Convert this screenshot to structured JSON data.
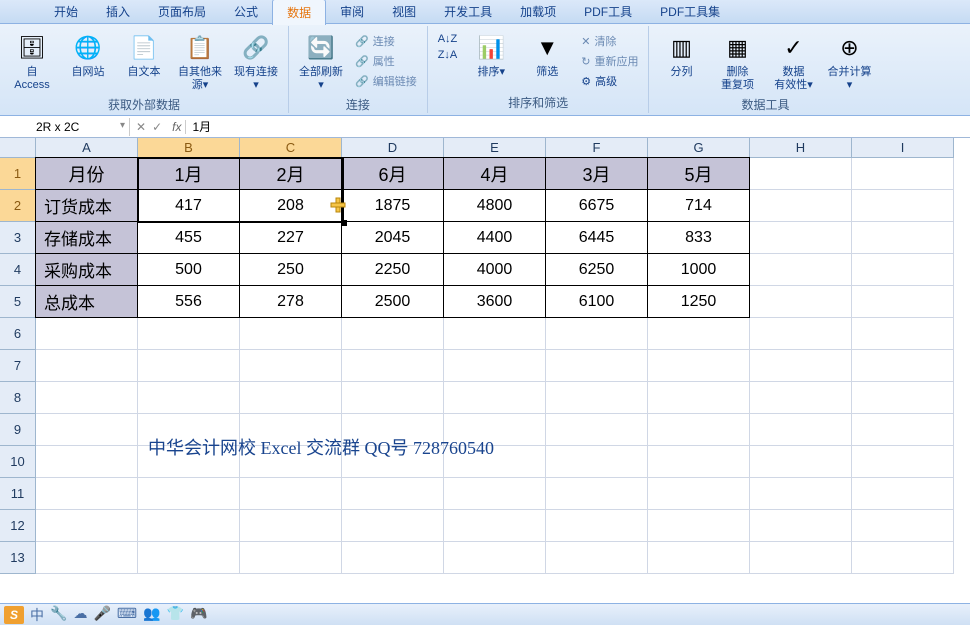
{
  "ribbon": {
    "tabs": [
      "开始",
      "插入",
      "页面布局",
      "公式",
      "数据",
      "审阅",
      "视图",
      "开发工具",
      "加载项",
      "PDF工具",
      "PDF工具集"
    ],
    "active_tab": "数据",
    "groups": {
      "get_data": {
        "label": "获取外部数据",
        "items": [
          "自 Access",
          "自网站",
          "自文本",
          "自其他来源",
          "现有连接"
        ]
      },
      "connections": {
        "label": "连接",
        "main": "全部刷新",
        "sub": [
          "连接",
          "属性",
          "编辑链接"
        ]
      },
      "sort_filter": {
        "label": "排序和筛选",
        "sort_az": "A↓Z",
        "sort_za": "Z↓A",
        "sort": "排序",
        "filter": "筛选",
        "clear": "清除",
        "reapply": "重新应用",
        "advanced": "高级"
      },
      "data_tools": {
        "label": "数据工具",
        "items": [
          "分列",
          "删除\n重复项",
          "数据\n有效性",
          "合并计算"
        ]
      }
    }
  },
  "namebox": "2R x 2C",
  "formula": "1月",
  "cols": [
    "A",
    "B",
    "C",
    "D",
    "E",
    "F",
    "G",
    "H",
    "I"
  ],
  "selected_cols": [
    "B",
    "C"
  ],
  "selected_rows": [
    1,
    2
  ],
  "table": {
    "headers": [
      "月份",
      "1月",
      "2月",
      "6月",
      "4月",
      "3月",
      "5月"
    ],
    "rows": [
      [
        "订货成本",
        "417",
        "208",
        "1875",
        "4800",
        "6675",
        "714"
      ],
      [
        "存储成本",
        "455",
        "227",
        "2045",
        "4400",
        "6445",
        "833"
      ],
      [
        "采购成本",
        "500",
        "250",
        "2250",
        "4000",
        "6250",
        "1000"
      ],
      [
        "总成本",
        "556",
        "278",
        "2500",
        "3600",
        "6100",
        "1250"
      ]
    ]
  },
  "note": "中华会计网校 Excel 交流群 QQ号   728760540",
  "status_icons": [
    "中",
    "🔧",
    "☁",
    "🎤",
    "⌨",
    "👥",
    "👕",
    "🎮"
  ]
}
